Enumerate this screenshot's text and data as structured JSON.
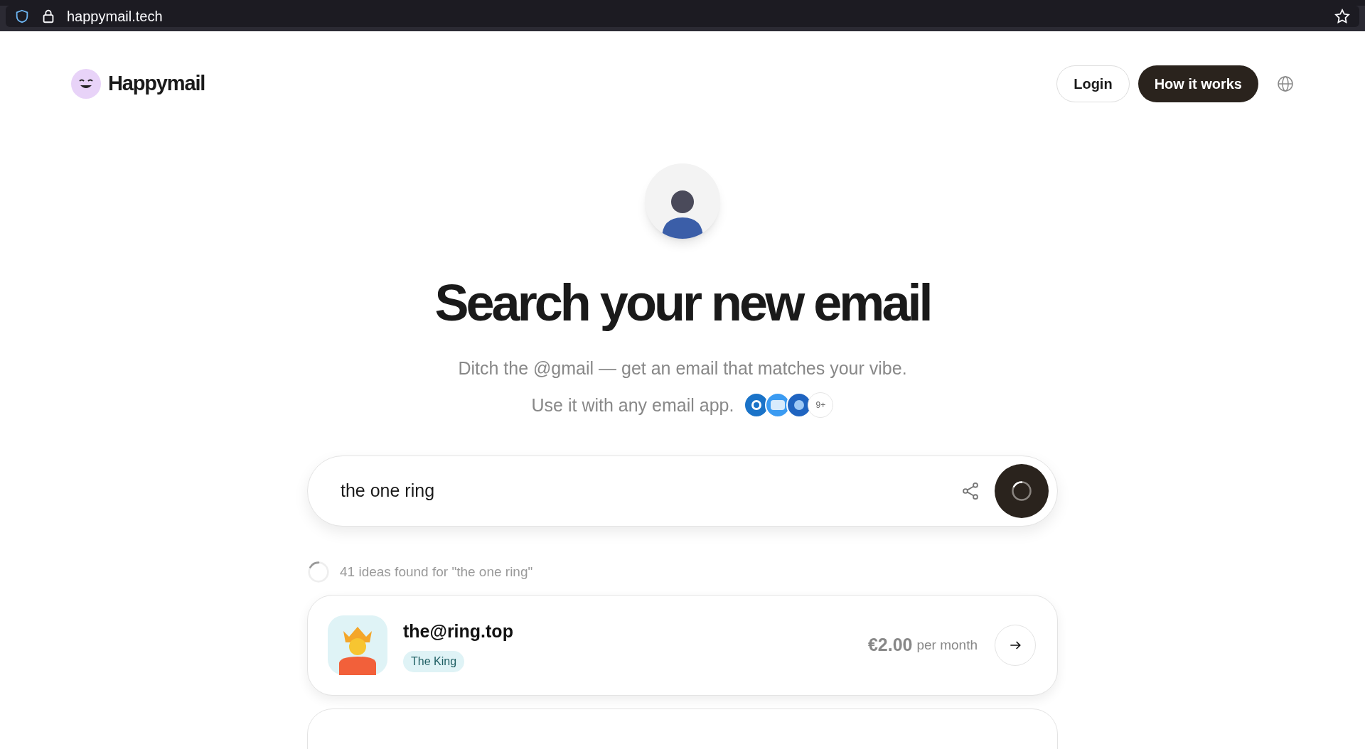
{
  "browser": {
    "url": "happymail.tech"
  },
  "header": {
    "logo": "Happymail",
    "login": "Login",
    "cta": "How it works"
  },
  "hero": {
    "title": "Search your new email",
    "subtitle": "Ditch the @gmail — get an email that matches your vibe.",
    "apps_line": "Use it with any email app.",
    "apps_more": "9+"
  },
  "search": {
    "value": "the one ring",
    "loading": true
  },
  "results_summary": "41 ideas found for \"the one ring\"",
  "results": [
    {
      "email": "the@ring.top",
      "tag": "The King",
      "price": "€2.00",
      "period": "per month"
    }
  ]
}
